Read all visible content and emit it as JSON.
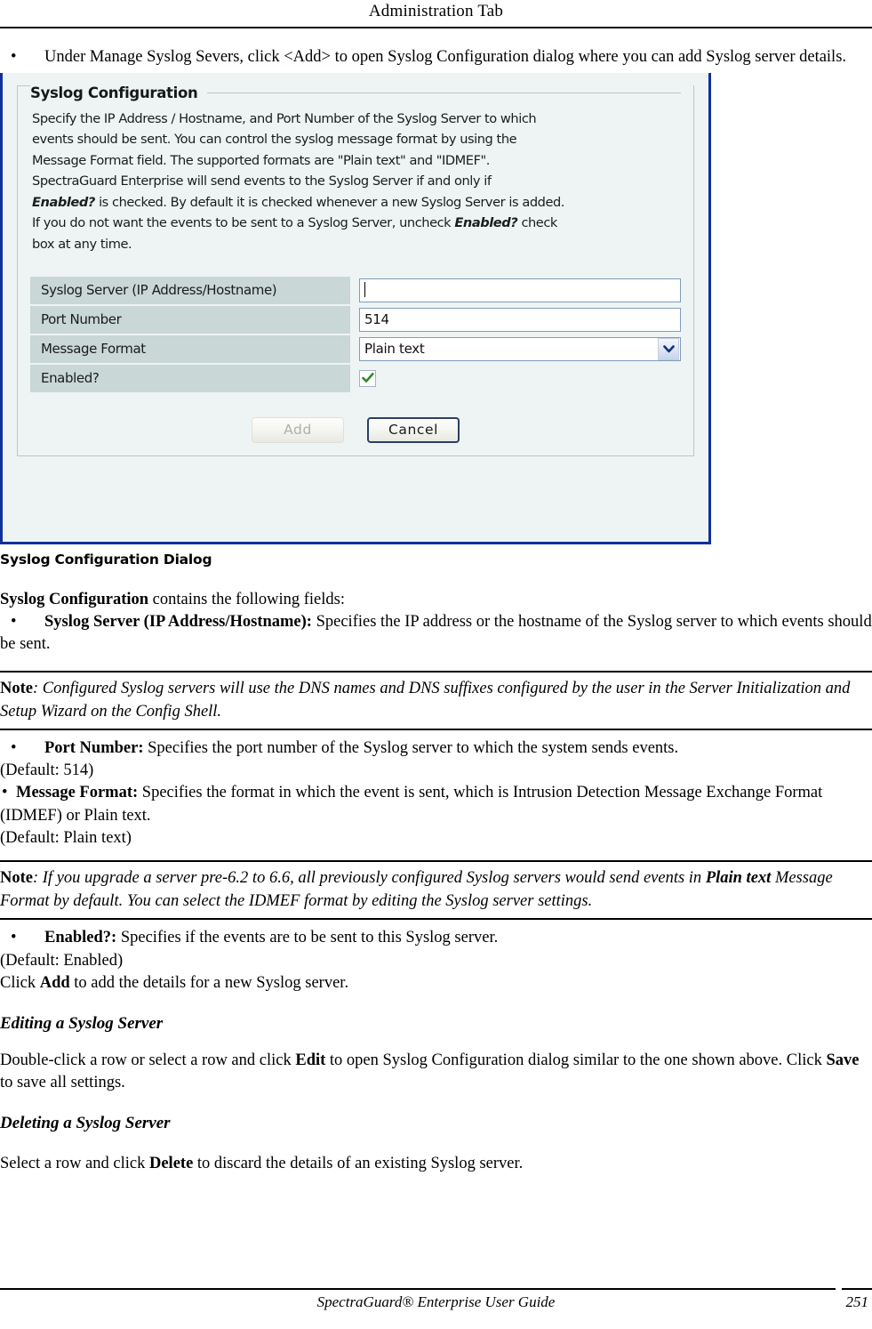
{
  "header": {
    "title": "Administration Tab"
  },
  "intro_bullet": {
    "bullet": "•",
    "text": "Under Manage Syslog Severs, click <Add> to open Syslog Configuration dialog where you can add Syslog server details."
  },
  "dialog": {
    "title": "Syslog Configuration",
    "close_icon": "close-icon",
    "group_legend": "Syslog Configuration",
    "description_lines": [
      "Specify the IP Address / Hostname, and Port Number of the Syslog Server to which",
      "events should be sent. You can control the syslog message format by using the",
      "Message Format field. The supported formats are \"Plain text\" and \"IDMEF\".",
      "SpectraGuard Enterprise will send events to the Syslog Server if and only if"
    ],
    "description_rich": {
      "line5_bold": "Enabled?",
      "line5_rest": " is checked. By default it is checked whenever a new Syslog Server is added.",
      "line6_pre": "If you do not want the events to be sent to a Syslog Server, uncheck ",
      "line6_bold": "Enabled?",
      "line6_post": " check",
      "line7": "box at any time."
    },
    "fields": [
      {
        "label": "Syslog Server (IP Address/Hostname)",
        "value": "",
        "type": "text"
      },
      {
        "label": "Port Number",
        "value": "514",
        "type": "text"
      },
      {
        "label": "Message Format",
        "value": "Plain text",
        "type": "select"
      },
      {
        "label": "Enabled?",
        "value": "checked",
        "type": "checkbox"
      }
    ],
    "buttons": {
      "add": "Add",
      "cancel": "Cancel"
    },
    "colors": {
      "titlebar": "#0b45c4",
      "border": "#10309c",
      "close": "#e8602c",
      "label_cell": "#c9d7d6",
      "body": "#eef4f3",
      "check": "#3b9b2f"
    }
  },
  "figure_caption": "Syslog Configuration Dialog",
  "body": {
    "contains_bold": "Syslog Configuration",
    "contains_rest": " contains the following fields:",
    "b1_bullet": "•",
    "b1_bold": "Syslog Server (IP Address/Hostname):",
    "b1_rest": " Specifies the IP address or the hostname of the Syslog server to which events should be sent.",
    "note1_label": "Note",
    "note1_text": ": Configured Syslog servers will use the DNS names and DNS suffixes configured by the user in the Server Initialization and Setup Wizard on the Config Shell.",
    "b2_bullet": "•",
    "b2_bold": "Port Number:",
    "b2_rest": " Specifies the port number of the Syslog server to which the system sends events.",
    "b2_default": "(Default: 514)",
    "b3_bullet": "•",
    "b3_bold": "Message Format:",
    "b3_rest": " Specifies the format in which the event is sent, which is Intrusion Detection Message Exchange Format (IDMEF) or Plain text.",
    "b3_default": "(Default: Plain text)",
    "note2_label": "Note",
    "note2_a": ": If you upgrade a server pre-6.2 to 6.6, all previously configured Syslog servers would send events in ",
    "note2_bold1": "Plain text",
    "note2_b": " Message Format by default. You can select the IDMEF format by editing the Syslog server settings.",
    "b4_bullet": "•",
    "b4_bold": "Enabled?:",
    "b4_rest": " Specifies if the events are to be sent to this Syslog server.",
    "b4_default": "(Default: Enabled)",
    "click_add_pre": "Click ",
    "click_add_bold": "Add",
    "click_add_post": " to add the details for a new Syslog server.",
    "head_editing": "Editing a Syslog Server",
    "editing_pre": "Double-click a row or select a row and click ",
    "editing_bold1": "Edit",
    "editing_mid": " to open Syslog Configuration dialog similar to the one shown above. Click ",
    "editing_bold2": "Save",
    "editing_post": " to save all settings.",
    "head_deleting": "Deleting a Syslog Server",
    "deleting_pre": "Select a row and click ",
    "deleting_bold": "Delete",
    "deleting_post": " to discard the details of an existing Syslog server."
  },
  "footer": {
    "guide": "SpectraGuard® Enterprise User Guide",
    "page": "251"
  }
}
